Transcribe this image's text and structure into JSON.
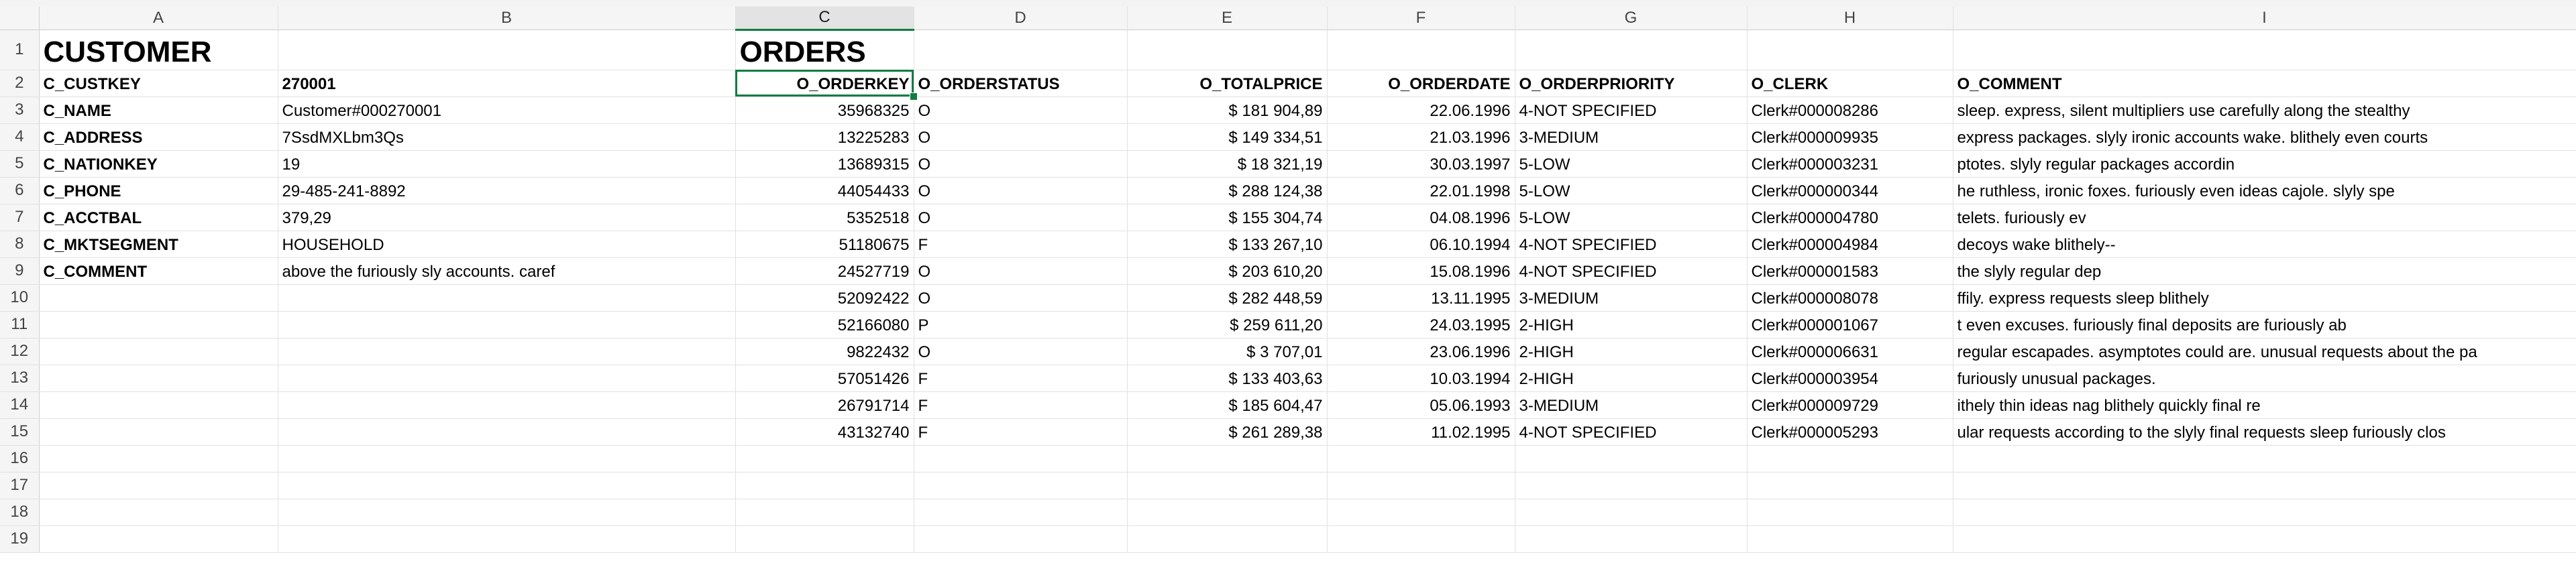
{
  "columns": [
    "A",
    "B",
    "C",
    "D",
    "E",
    "F",
    "G",
    "H",
    "I"
  ],
  "selected_column": "C",
  "rows": [
    {
      "n": "1",
      "cells": [
        "CUSTOMER",
        "",
        "ORDERS",
        "",
        "",
        "",
        "",
        "",
        ""
      ]
    },
    {
      "n": "2",
      "cells": [
        "C_CUSTKEY",
        "270001",
        "O_ORDERKEY",
        "O_ORDERSTATUS",
        "O_TOTALPRICE",
        "O_ORDERDATE",
        "O_ORDERPRIORITY",
        "O_CLERK",
        "O_COMMENT"
      ]
    },
    {
      "n": "3",
      "cells": [
        "C_NAME",
        "Customer#000270001",
        "35968325",
        "O",
        "$ 181 904,89",
        "22.06.1996",
        "4-NOT SPECIFIED",
        "Clerk#000008286",
        "sleep. express, silent multipliers use carefully along the stealthy"
      ]
    },
    {
      "n": "4",
      "cells": [
        "C_ADDRESS",
        "7SsdMXLbm3Qs",
        "13225283",
        "O",
        "$ 149 334,51",
        "21.03.1996",
        "3-MEDIUM",
        "Clerk#000009935",
        " express packages. slyly ironic accounts wake. blithely even courts"
      ]
    },
    {
      "n": "5",
      "cells": [
        "C_NATIONKEY",
        "19",
        "13689315",
        "O",
        "$ 18 321,19",
        "30.03.1997",
        "5-LOW",
        "Clerk#000003231",
        "ptotes. slyly regular packages accordin"
      ]
    },
    {
      "n": "6",
      "cells": [
        "C_PHONE",
        "29-485-241-8892",
        "44054433",
        "O",
        "$ 288 124,38",
        "22.01.1998",
        "5-LOW",
        "Clerk#000000344",
        "he ruthless, ironic foxes. furiously even ideas cajole. slyly spe"
      ]
    },
    {
      "n": "7",
      "cells": [
        "C_ACCTBAL",
        "379,29",
        "5352518",
        "O",
        "$ 155 304,74",
        "04.08.1996",
        "5-LOW",
        "Clerk#000004780",
        "telets. furiously ev"
      ]
    },
    {
      "n": "8",
      "cells": [
        "C_MKTSEGMENT",
        "HOUSEHOLD",
        "51180675",
        "F",
        "$ 133 267,10",
        "06.10.1994",
        "4-NOT SPECIFIED",
        "Clerk#000004984",
        "decoys wake blithely--"
      ]
    },
    {
      "n": "9",
      "cells": [
        "C_COMMENT",
        " above the furiously sly accounts. caref",
        "24527719",
        "O",
        "$ 203 610,20",
        "15.08.1996",
        "4-NOT SPECIFIED",
        "Clerk#000001583",
        " the slyly regular dep"
      ]
    },
    {
      "n": "10",
      "cells": [
        "",
        "",
        "52092422",
        "O",
        "$ 282 448,59",
        "13.11.1995",
        "3-MEDIUM",
        "Clerk#000008078",
        "ffily. express requests sleep blithely"
      ]
    },
    {
      "n": "11",
      "cells": [
        "",
        "",
        "52166080",
        "P",
        "$ 259 611,20",
        "24.03.1995",
        "2-HIGH",
        "Clerk#000001067",
        "t even excuses. furiously final deposits are furiously ab"
      ]
    },
    {
      "n": "12",
      "cells": [
        "",
        "",
        "9822432",
        "O",
        "$ 3 707,01",
        "23.06.1996",
        "2-HIGH",
        "Clerk#000006631",
        "regular escapades. asymptotes could are. unusual requests about the pa"
      ]
    },
    {
      "n": "13",
      "cells": [
        "",
        "",
        "57051426",
        "F",
        "$ 133 403,63",
        "10.03.1994",
        "2-HIGH",
        "Clerk#000003954",
        " furiously unusual packages."
      ]
    },
    {
      "n": "14",
      "cells": [
        "",
        "",
        "26791714",
        "F",
        "$ 185 604,47",
        "05.06.1993",
        "3-MEDIUM",
        "Clerk#000009729",
        "ithely thin ideas nag blithely quickly final re"
      ]
    },
    {
      "n": "15",
      "cells": [
        "",
        "",
        "43132740",
        "F",
        "$ 261 289,38",
        "11.02.1995",
        "4-NOT SPECIFIED",
        "Clerk#000005293",
        "ular requests according to the slyly final requests sleep furiously clos"
      ]
    },
    {
      "n": "16",
      "cells": [
        "",
        "",
        "",
        "",
        "",
        "",
        "",
        "",
        ""
      ]
    },
    {
      "n": "17",
      "cells": [
        "",
        "",
        "",
        "",
        "",
        "",
        "",
        "",
        ""
      ]
    },
    {
      "n": "18",
      "cells": [
        "",
        "",
        "",
        "",
        "",
        "",
        "",
        "",
        ""
      ]
    },
    {
      "n": "19",
      "cells": [
        "",
        "",
        "",
        "",
        "",
        "",
        "",
        "",
        ""
      ]
    }
  ]
}
